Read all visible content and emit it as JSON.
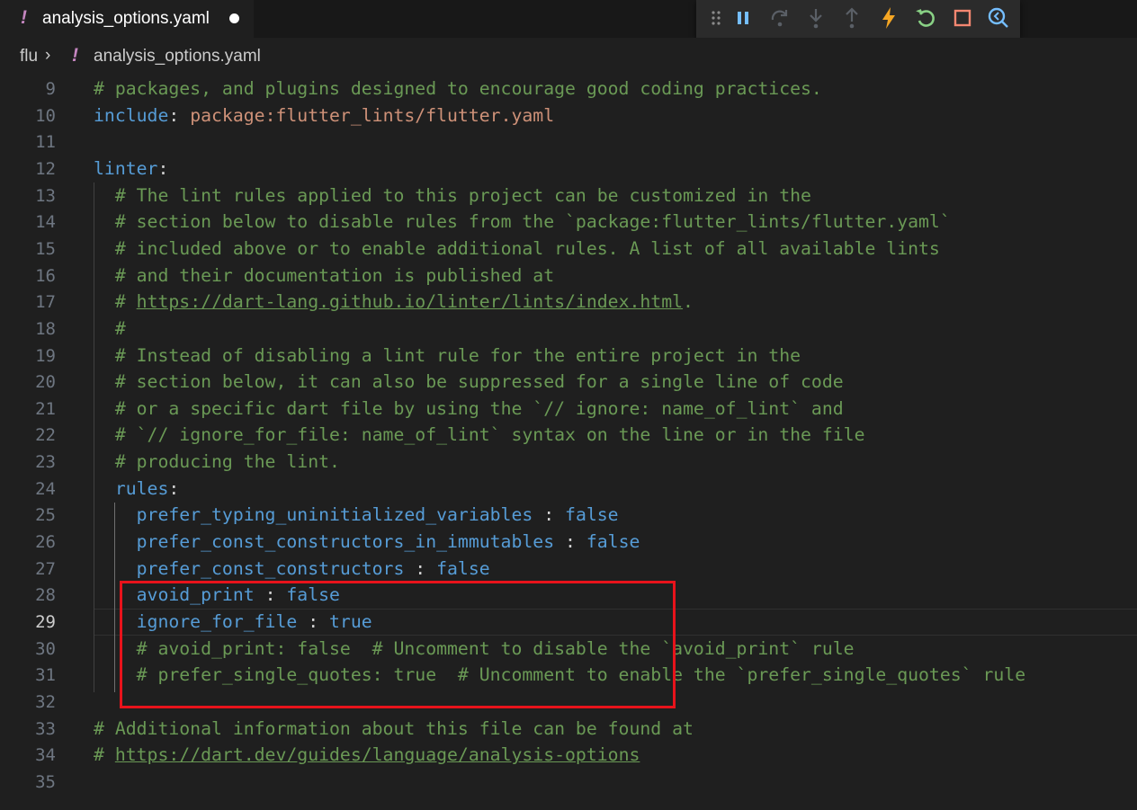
{
  "tab": {
    "icon": "!",
    "title": "analysis_options.yaml",
    "dirty_indicator": "unsaved-dot"
  },
  "breadcrumb": {
    "root": "flu",
    "separator": "›",
    "icon": "!",
    "file": "analysis_options.yaml"
  },
  "debug_toolbar": {
    "buttons": [
      "drag-handle-icon",
      "pause-icon",
      "step-over-icon",
      "step-into-icon",
      "step-out-icon",
      "hot-reload-icon",
      "restart-icon",
      "stop-icon",
      "devtools-icon"
    ],
    "colors": {
      "active": "#75beff",
      "disabled": "#5a5f66",
      "hot_reload": "#f5a623",
      "restart": "#89d185",
      "stop": "#f48771"
    }
  },
  "editor": {
    "current_line": "29",
    "lines": [
      {
        "n": "9",
        "t": [
          [
            "c",
            "# packages, and plugins designed to encourage good coding practices."
          ]
        ]
      },
      {
        "n": "10",
        "t": [
          [
            "k",
            "include"
          ],
          [
            "p",
            ": "
          ],
          [
            "s",
            "package:flutter_lints/flutter.yaml"
          ]
        ]
      },
      {
        "n": "11",
        "t": []
      },
      {
        "n": "12",
        "t": [
          [
            "k",
            "linter"
          ],
          [
            "p",
            ":"
          ]
        ]
      },
      {
        "n": "13",
        "t": [
          [
            "p",
            "  "
          ],
          [
            "c",
            "# The lint rules applied to this project can be customized in the"
          ]
        ]
      },
      {
        "n": "14",
        "t": [
          [
            "p",
            "  "
          ],
          [
            "c",
            "# section below to disable rules from the `package:flutter_lints/flutter.yaml`"
          ]
        ]
      },
      {
        "n": "15",
        "t": [
          [
            "p",
            "  "
          ],
          [
            "c",
            "# included above or to enable additional rules. A list of all available lints"
          ]
        ]
      },
      {
        "n": "16",
        "t": [
          [
            "p",
            "  "
          ],
          [
            "c",
            "# and their documentation is published at"
          ]
        ]
      },
      {
        "n": "17",
        "t": [
          [
            "p",
            "  "
          ],
          [
            "c",
            "# "
          ],
          [
            "cl",
            "https://dart-lang.github.io/linter/lints/index.html"
          ],
          [
            "c",
            "."
          ]
        ]
      },
      {
        "n": "18",
        "t": [
          [
            "p",
            "  "
          ],
          [
            "c",
            "#"
          ]
        ]
      },
      {
        "n": "19",
        "t": [
          [
            "p",
            "  "
          ],
          [
            "c",
            "# Instead of disabling a lint rule for the entire project in the"
          ]
        ]
      },
      {
        "n": "20",
        "t": [
          [
            "p",
            "  "
          ],
          [
            "c",
            "# section below, it can also be suppressed for a single line of code"
          ]
        ]
      },
      {
        "n": "21",
        "t": [
          [
            "p",
            "  "
          ],
          [
            "c",
            "# or a specific dart file by using the `// ignore: name_of_lint` and"
          ]
        ]
      },
      {
        "n": "22",
        "t": [
          [
            "p",
            "  "
          ],
          [
            "c",
            "# `// ignore_for_file: name_of_lint` syntax on the line or in the file"
          ]
        ]
      },
      {
        "n": "23",
        "t": [
          [
            "p",
            "  "
          ],
          [
            "c",
            "# producing the lint."
          ]
        ]
      },
      {
        "n": "24",
        "t": [
          [
            "p",
            "  "
          ],
          [
            "k",
            "rules"
          ],
          [
            "p",
            ":"
          ]
        ]
      },
      {
        "n": "25",
        "t": [
          [
            "p",
            "    "
          ],
          [
            "k",
            "prefer_typing_uninitialized_variables"
          ],
          [
            "p",
            " : "
          ],
          [
            "b",
            "false"
          ]
        ]
      },
      {
        "n": "26",
        "t": [
          [
            "p",
            "    "
          ],
          [
            "k",
            "prefer_const_constructors_in_immutables"
          ],
          [
            "p",
            " : "
          ],
          [
            "b",
            "false"
          ]
        ]
      },
      {
        "n": "27",
        "t": [
          [
            "p",
            "    "
          ],
          [
            "k",
            "prefer_const_constructors"
          ],
          [
            "p",
            " : "
          ],
          [
            "b",
            "false"
          ]
        ]
      },
      {
        "n": "28",
        "t": [
          [
            "p",
            "    "
          ],
          [
            "k",
            "avoid_print"
          ],
          [
            "p",
            " : "
          ],
          [
            "b",
            "false"
          ]
        ]
      },
      {
        "n": "29",
        "t": [
          [
            "p",
            "    "
          ],
          [
            "k",
            "ignore_for_file"
          ],
          [
            "p",
            " : "
          ],
          [
            "b",
            "true"
          ]
        ]
      },
      {
        "n": "30",
        "t": [
          [
            "p",
            "    "
          ],
          [
            "c",
            "# avoid_print: false  # Uncomment to disable the `avoid_print` rule"
          ]
        ]
      },
      {
        "n": "31",
        "t": [
          [
            "p",
            "    "
          ],
          [
            "c",
            "# prefer_single_quotes: true  # Uncomment to enable the `prefer_single_quotes` rule"
          ]
        ]
      },
      {
        "n": "32",
        "t": []
      },
      {
        "n": "33",
        "t": [
          [
            "c",
            "# Additional information about this file can be found at"
          ]
        ]
      },
      {
        "n": "34",
        "t": [
          [
            "c",
            "# "
          ],
          [
            "cl",
            "https://dart.dev/guides/language/analysis-options"
          ]
        ]
      },
      {
        "n": "35",
        "t": []
      }
    ]
  },
  "annotation": {
    "color": "#e8131b",
    "covers_lines": [
      "25",
      "29"
    ]
  }
}
